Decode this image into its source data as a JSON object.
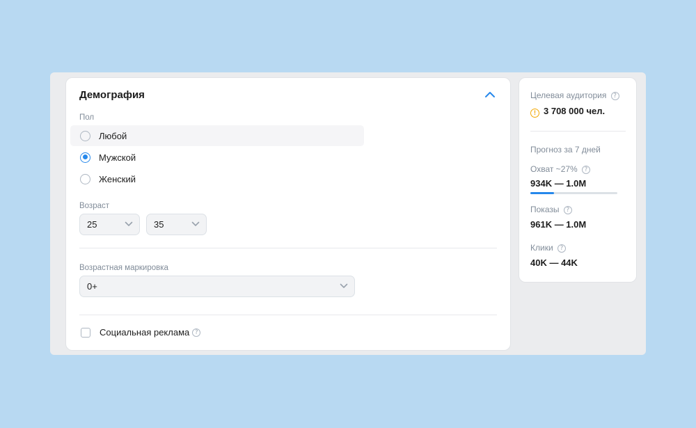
{
  "colors": {
    "accent": "#2688eb",
    "warning": "#f2a700",
    "page_bg": "#b8d9f2"
  },
  "demography": {
    "title": "Демография",
    "gender": {
      "label": "Пол",
      "options": [
        "Любой",
        "Мужской",
        "Женский"
      ],
      "selected": "Мужской"
    },
    "age": {
      "label": "Возраст",
      "from": "25",
      "to": "35"
    },
    "age_rating": {
      "label": "Возрастная маркировка",
      "value": "0+"
    },
    "social_ad": {
      "label": "Социальная реклама",
      "checked": false
    }
  },
  "audience": {
    "label": "Целевая аудитория",
    "value": "3 708 000 чел.",
    "forecast_title": "Прогноз за 7 дней",
    "reach": {
      "label": "Охват ~27%",
      "value": "934K — 1.0M",
      "progress_percent": 27
    },
    "impressions": {
      "label": "Показы",
      "value": "961K — 1.0M"
    },
    "clicks": {
      "label": "Клики",
      "value": "40K — 44K"
    }
  },
  "icons": {
    "collapse": "chevron-up-icon",
    "dropdown": "chevron-down-icon",
    "help": "question-circle-icon",
    "warning": "warning-circle-icon"
  }
}
